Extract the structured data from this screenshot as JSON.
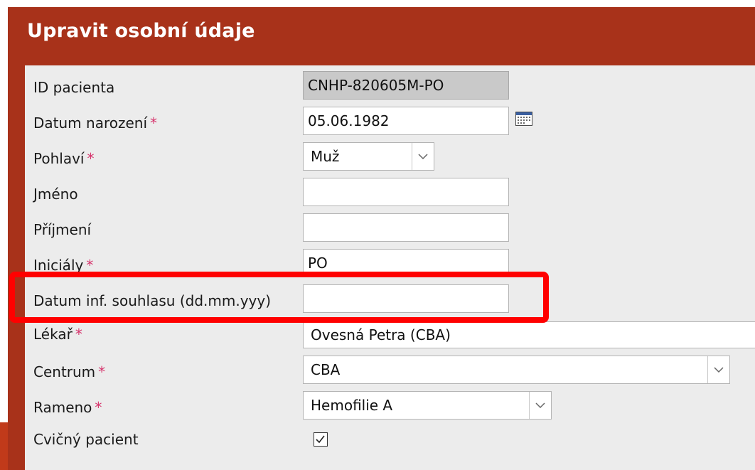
{
  "title": "Upravit osobní údaje",
  "required_mark": "*",
  "fields": {
    "patient_id": {
      "label": "ID pacienta",
      "value": "CNHP-820605M-PO"
    },
    "birth_date": {
      "label": "Datum narození",
      "value": "05.06.1982"
    },
    "gender": {
      "label": "Pohlaví",
      "value": "Muž"
    },
    "first_name": {
      "label": "Jméno",
      "value": ""
    },
    "last_name": {
      "label": "Příjmení",
      "value": ""
    },
    "initials": {
      "label": "Iniciály",
      "value": "PO"
    },
    "consent_date": {
      "label": "Datum inf. souhlasu (dd.mm.yyy)",
      "value": ""
    },
    "doctor": {
      "label": "Lékař",
      "value": "Ovesná Petra (CBA)"
    },
    "center": {
      "label": "Centrum",
      "value": "CBA"
    },
    "arm": {
      "label": "Rameno",
      "value": "Hemofilie A"
    },
    "practice_patient": {
      "label": "Cvičný pacient",
      "checked": true
    }
  },
  "icons": {
    "calendar": "calendar-icon",
    "dropdown": "chevron-down-icon",
    "checkbox": "checkmark-icon"
  },
  "colors": {
    "header": "#a8321a",
    "highlight": "#ff0000",
    "required": "#d6336c"
  }
}
